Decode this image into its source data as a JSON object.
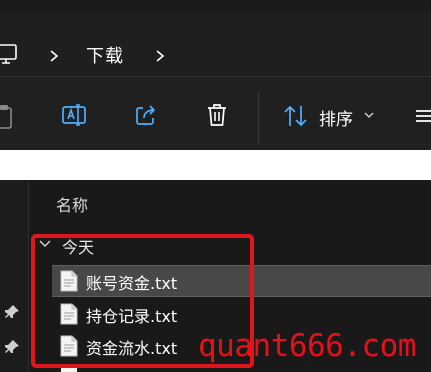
{
  "address_bar": {
    "breadcrumb": "下载"
  },
  "toolbar": {
    "sort_label": "排序"
  },
  "file_list": {
    "column_name": "名称",
    "group_label": "今天",
    "files": [
      {
        "name": "账号资金.txt",
        "selected": true
      },
      {
        "name": "持仓记录.txt",
        "selected": false
      },
      {
        "name": "资金流水.txt",
        "selected": false
      }
    ]
  },
  "annotation": {
    "box_color": "#e0161f"
  },
  "watermark": {
    "text": "quant666.com",
    "color": "#e81018"
  }
}
